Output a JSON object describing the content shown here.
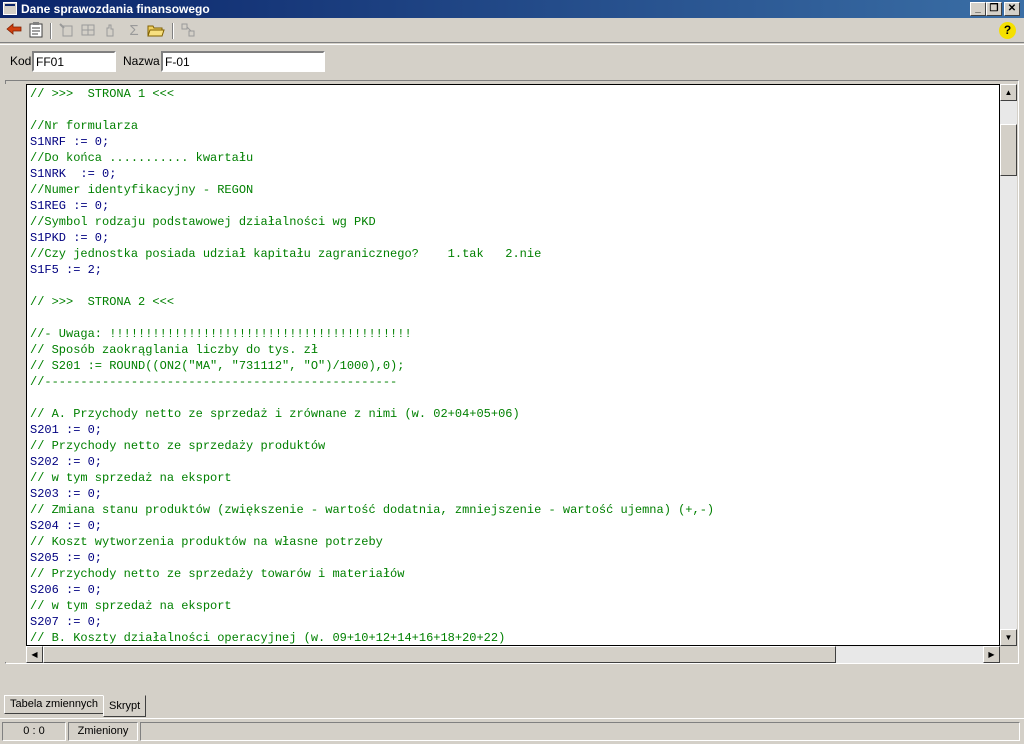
{
  "window": {
    "title": "Dane sprawozdania finansowego",
    "buttons": {
      "minimize": "_",
      "restore": "❐",
      "close": "✕"
    }
  },
  "toolbar": {
    "icons": [
      "back-arrow-icon",
      "notepad-icon",
      "insert-icon",
      "grid-icon",
      "hand-icon",
      "sigma-icon",
      "open-folder-icon",
      "variables-icon",
      "help-icon"
    ],
    "sigma": "Σ",
    "help": "?"
  },
  "fields": {
    "kod_label": "Kod",
    "kod_value": "FF01",
    "nazwa_label": "Nazwa",
    "nazwa_value": "F-01"
  },
  "editor": {
    "lines": [
      {
        "text": "// >>>  STRONA 1 <<<",
        "kind": "comment"
      },
      {
        "text": "",
        "kind": "code"
      },
      {
        "text": "//Nr formularza",
        "kind": "comment"
      },
      {
        "text": "S1NRF := 0;",
        "kind": "code"
      },
      {
        "text": "//Do końca ........... kwartału",
        "kind": "comment"
      },
      {
        "text": "S1NRK  := 0;",
        "kind": "code"
      },
      {
        "text": "//Numer identyfikacyjny - REGON",
        "kind": "comment"
      },
      {
        "text": "S1REG := 0;",
        "kind": "code"
      },
      {
        "text": "//Symbol rodzaju podstawowej działalności wg PKD",
        "kind": "comment"
      },
      {
        "text": "S1PKD := 0;",
        "kind": "code"
      },
      {
        "text": "//Czy jednostka posiada udział kapitału zagranicznego?    1.tak   2.nie",
        "kind": "comment"
      },
      {
        "text": "S1F5 := 2;",
        "kind": "code"
      },
      {
        "text": "",
        "kind": "code"
      },
      {
        "text": "// >>>  STRONA 2 <<<",
        "kind": "comment"
      },
      {
        "text": "",
        "kind": "code"
      },
      {
        "text": "//- Uwaga: !!!!!!!!!!!!!!!!!!!!!!!!!!!!!!!!!!!!!!!!!!",
        "kind": "comment"
      },
      {
        "text": "// Sposób zaokrąglania liczby do tys. zł",
        "kind": "comment"
      },
      {
        "text": "// S201 := ROUND((ON2(\"MA\", \"731112\", \"O\")/1000),0);",
        "kind": "comment"
      },
      {
        "text": "//-------------------------------------------------",
        "kind": "comment"
      },
      {
        "text": "",
        "kind": "code"
      },
      {
        "text": "// A. Przychody netto ze sprzedaż i zrównane z nimi (w. 02+04+05+06)",
        "kind": "comment"
      },
      {
        "text": "S201 := 0;",
        "kind": "code"
      },
      {
        "text": "// Przychody netto ze sprzedaży produktów",
        "kind": "comment"
      },
      {
        "text": "S202 := 0;",
        "kind": "code"
      },
      {
        "text": "// w tym sprzedaż na eksport",
        "kind": "comment"
      },
      {
        "text": "S203 := 0;",
        "kind": "code"
      },
      {
        "text": "// Zmiana stanu produktów (zwiększenie - wartość dodatnia, zmniejszenie - wartość ujemna) (+,-)",
        "kind": "comment"
      },
      {
        "text": "S204 := 0;",
        "kind": "code"
      },
      {
        "text": "// Koszt wytworzenia produktów na własne potrzeby",
        "kind": "comment"
      },
      {
        "text": "S205 := 0;",
        "kind": "code"
      },
      {
        "text": "// Przychody netto ze sprzedaży towarów i materiałów",
        "kind": "comment"
      },
      {
        "text": "S206 := 0;",
        "kind": "code"
      },
      {
        "text": "// w tym sprzedaż na eksport",
        "kind": "comment"
      },
      {
        "text": "S207 := 0;",
        "kind": "code"
      },
      {
        "text": "// B. Koszty działalności operacyjnej (w. 09+10+12+14+16+18+20+22)",
        "kind": "comment"
      }
    ]
  },
  "scroll": {
    "up": "▲",
    "down": "▼",
    "left": "◀",
    "right": "▶"
  },
  "tabs": [
    {
      "label": "Tabela zmiennych",
      "active": false
    },
    {
      "label": "Skrypt",
      "active": true
    }
  ],
  "status": {
    "position": "0 :  0",
    "state": "Zmieniony"
  },
  "colors": {
    "comment": "#008000",
    "code": "#000080",
    "titlebar_start": "#0a246a",
    "titlebar_end": "#3a6ea5"
  }
}
